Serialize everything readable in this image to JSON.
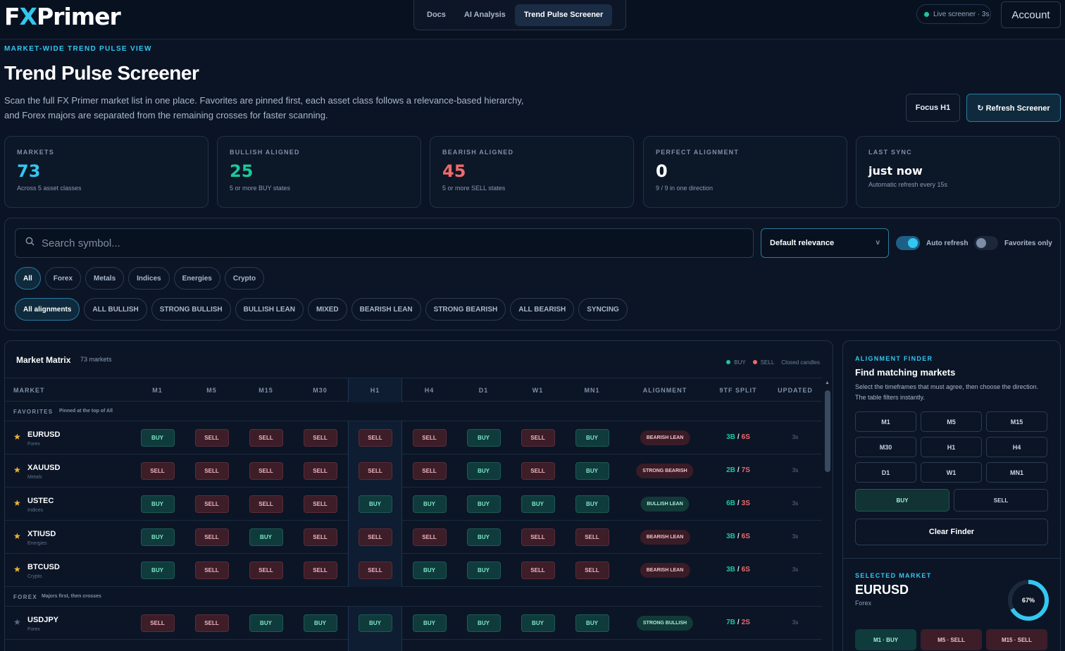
{
  "app": {
    "logo_a": "F",
    "logo_x": "X",
    "logo_b": "Primer"
  },
  "nav": {
    "tabs": [
      {
        "label": "Docs"
      },
      {
        "label": "AI Analysis"
      },
      {
        "label": "Trend Pulse Screener"
      }
    ],
    "active_tab": 2,
    "live_label": "Live screener · 3s",
    "account_label": "Account"
  },
  "header": {
    "eyebrow": "MARKET-WIDE TREND PULSE VIEW",
    "title": "Trend Pulse Screener",
    "description_1": "Scan the full FX Primer market list in one place. Favorites are pinned first, each asset class follows a relevance-based hierarchy,",
    "description_2": "and Forex majors are separated from the remaining crosses for faster scanning.",
    "focus_label": "Focus H1",
    "refresh_label": "↻ Refresh Screener"
  },
  "stats": [
    {
      "label": "MARKETS",
      "value": "73",
      "sub": "Across 5 asset classes",
      "color": "#33c7f0"
    },
    {
      "label": "BULLISH ALIGNED",
      "value": "25",
      "sub": "5 or more BUY states",
      "color": "#1fc79a"
    },
    {
      "label": "BEARISH ALIGNED",
      "value": "45",
      "sub": "5 or more SELL states",
      "color": "#f06a6a"
    },
    {
      "label": "PERFECT ALIGNMENT",
      "value": "0",
      "sub": "9 / 9 in one direction",
      "color": "#ffffff"
    },
    {
      "label": "LAST SYNC",
      "value": "just now",
      "sub": "Automatic refresh every 15s",
      "color": "#ffffff"
    }
  ],
  "filters": {
    "search_placeholder": "Search symbol...",
    "sort_value": "Default relevance",
    "sort_chevron": "v",
    "auto_refresh_label": "Auto refresh",
    "auto_refresh_on": true,
    "favorites_only_label": "Favorites only",
    "favorites_only_on": false,
    "asset_chips": [
      "All",
      "Forex",
      "Metals",
      "Indices",
      "Energies",
      "Crypto"
    ],
    "asset_active": 0,
    "alignment_chips": [
      "All alignments",
      "ALL BULLISH",
      "STRONG BULLISH",
      "BULLISH LEAN",
      "MIXED",
      "BEARISH LEAN",
      "STRONG BEARISH",
      "ALL BEARISH",
      "SYNCING"
    ],
    "alignment_active": 0
  },
  "matrix": {
    "title": "Market Matrix",
    "count": "73 markets",
    "legend_buy": "BUY",
    "legend_sell": "SELL",
    "legend_note": "Closed candles",
    "columns": [
      "MARKET",
      "M1",
      "M5",
      "M15",
      "M30",
      "H1",
      "H4",
      "D1",
      "W1",
      "MN1",
      "ALIGNMENT",
      "9TF SPLIT",
      "UPDATED"
    ],
    "groups": [
      {
        "title": "FAVORITES",
        "note": "Pinned at the top of All"
      },
      {
        "title": "FOREX",
        "note": "Majors first, then crosses"
      }
    ],
    "rows": [
      {
        "symbol": "EURUSD",
        "class": "Forex",
        "fav": true,
        "signals": [
          "BUY",
          "SELL",
          "SELL",
          "SELL",
          "SELL",
          "SELL",
          "BUY",
          "SELL",
          "BUY"
        ],
        "alignment": "BEARISH LEAN",
        "bias": "bear",
        "buys": "3B",
        "sells": "6S",
        "updated": "3s"
      },
      {
        "symbol": "XAUUSD",
        "class": "Metals",
        "fav": true,
        "signals": [
          "SELL",
          "SELL",
          "SELL",
          "SELL",
          "SELL",
          "SELL",
          "BUY",
          "SELL",
          "BUY"
        ],
        "alignment": "STRONG BEARISH",
        "bias": "bear",
        "buys": "2B",
        "sells": "7S",
        "updated": "3s"
      },
      {
        "symbol": "USTEC",
        "class": "Indices",
        "fav": true,
        "signals": [
          "BUY",
          "SELL",
          "SELL",
          "SELL",
          "BUY",
          "BUY",
          "BUY",
          "BUY",
          "BUY"
        ],
        "alignment": "BULLISH LEAN",
        "bias": "bull",
        "buys": "6B",
        "sells": "3S",
        "updated": "3s"
      },
      {
        "symbol": "XTIUSD",
        "class": "Energies",
        "fav": true,
        "signals": [
          "BUY",
          "SELL",
          "BUY",
          "SELL",
          "SELL",
          "SELL",
          "BUY",
          "SELL",
          "SELL"
        ],
        "alignment": "BEARISH LEAN",
        "bias": "bear",
        "buys": "3B",
        "sells": "6S",
        "updated": "3s"
      },
      {
        "symbol": "BTCUSD",
        "class": "Crypto",
        "fav": true,
        "signals": [
          "BUY",
          "SELL",
          "SELL",
          "SELL",
          "SELL",
          "BUY",
          "BUY",
          "SELL",
          "SELL"
        ],
        "alignment": "BEARISH LEAN",
        "bias": "bear",
        "buys": "3B",
        "sells": "6S",
        "updated": "3s"
      },
      {
        "symbol": "USDJPY",
        "class": "Forex",
        "fav": false,
        "signals": [
          "SELL",
          "SELL",
          "BUY",
          "BUY",
          "BUY",
          "BUY",
          "BUY",
          "BUY",
          "BUY"
        ],
        "alignment": "STRONG BULLISH",
        "bias": "bull",
        "buys": "7B",
        "sells": "2S",
        "updated": "3s"
      }
    ],
    "split_separator": "/"
  },
  "finder": {
    "eyebrow": "ALIGNMENT FINDER",
    "title": "Find matching markets",
    "description": "Select the timeframes that must agree, then choose the direction. The table filters instantly.",
    "timeframes": [
      "M1",
      "M5",
      "M15",
      "M30",
      "H1",
      "H4",
      "D1",
      "W1",
      "MN1"
    ],
    "buy_label": "BUY",
    "sell_label": "SELL",
    "direction_active": "BUY",
    "clear_label": "Clear Finder"
  },
  "selected": {
    "eyebrow": "SELECTED MARKET",
    "symbol": "EURUSD",
    "class": "Forex",
    "ring_value": 0.67,
    "ring_label": "67%",
    "mini": [
      {
        "label": "M1 · BUY",
        "dir": "buy"
      },
      {
        "label": "M5 · SELL",
        "dir": "sell"
      },
      {
        "label": "M15 · SELL",
        "dir": "sell"
      }
    ]
  }
}
